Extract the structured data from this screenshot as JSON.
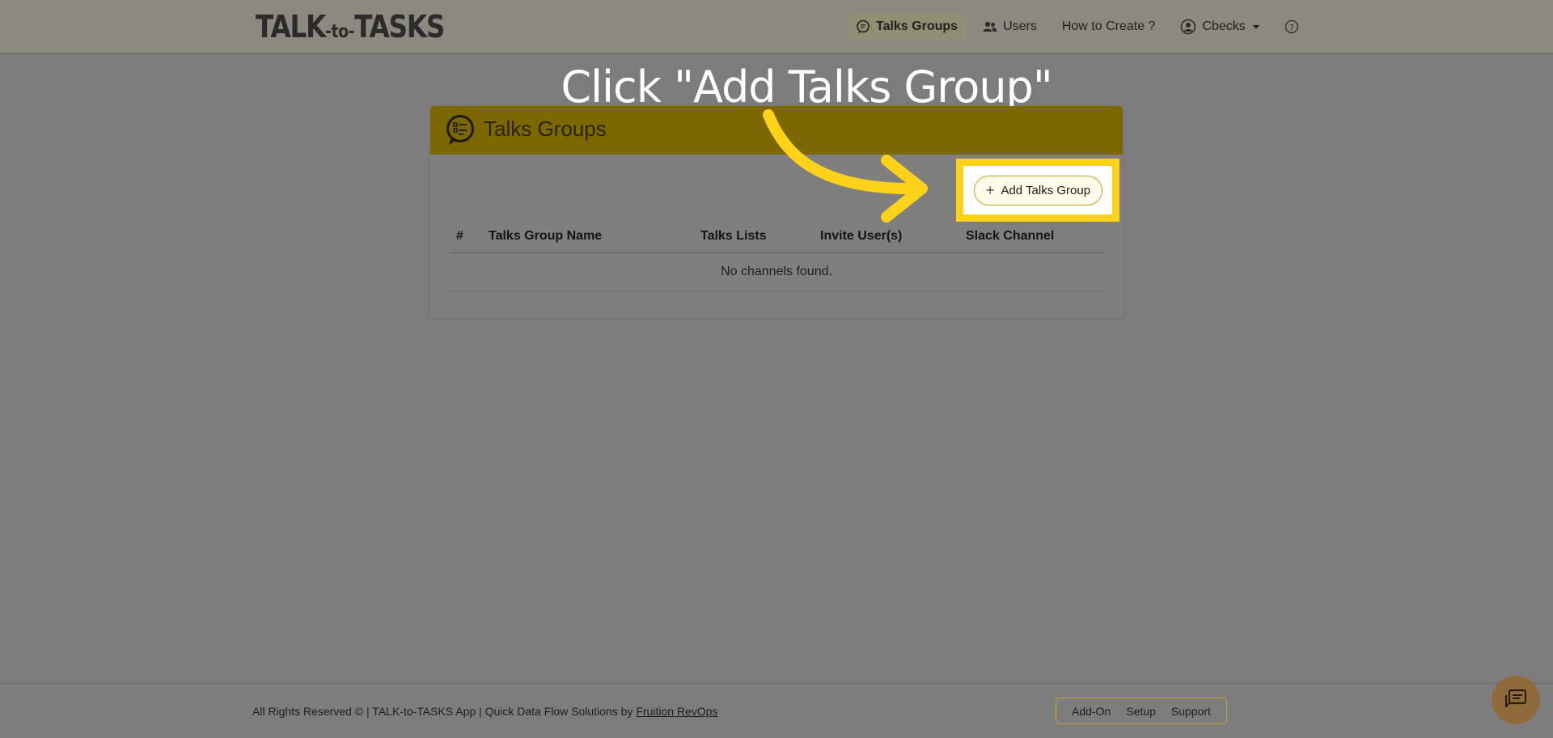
{
  "brand": {
    "part1": "TALK",
    "part2": "-to-",
    "part3": "TASKS"
  },
  "nav": {
    "items": [
      {
        "label": "Talks Groups",
        "icon": "chat-icon",
        "active": true
      },
      {
        "label": "Users",
        "icon": "users-icon",
        "active": false
      },
      {
        "label": "How to Create ?",
        "icon": "",
        "active": false
      },
      {
        "label": "Cbecks",
        "icon": "user-circle-icon",
        "active": false
      },
      {
        "label": "",
        "icon": "help-icon",
        "active": false
      }
    ]
  },
  "instruction": "Click \"Add Talks Group\"",
  "card": {
    "title": "Talks Groups",
    "add_button_label": "Add Talks Group",
    "table": {
      "headers": [
        "#",
        "Talks Group Name",
        "Talks Lists",
        "Invite User(s)",
        "Slack Channel"
      ],
      "empty_message": "No channels found."
    }
  },
  "footer": {
    "copyright": "All Rights Reserved © | TALK-to-TASKS App | Quick Data Flow Solutions by ",
    "company_link": "Fruition RevOps",
    "links": [
      "Add-On",
      "Setup",
      "Support"
    ]
  },
  "colors": {
    "accent": "#ffd21a",
    "header_band": "#7d6700",
    "overlay": "#7c7c7c"
  }
}
